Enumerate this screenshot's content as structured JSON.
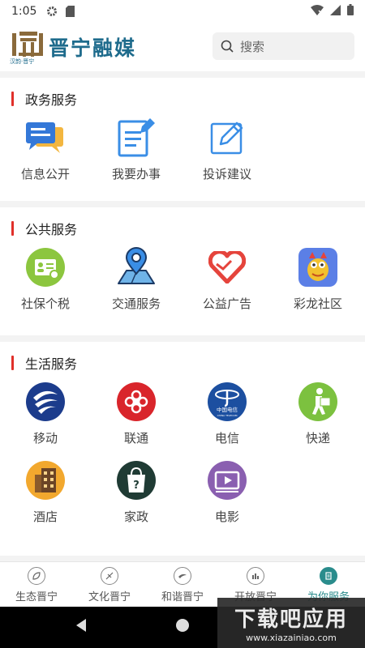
{
  "status": {
    "time": "1:05"
  },
  "header": {
    "app_name": "晋宁融媒",
    "logo_subtext": "汉韵·晋宁",
    "search_placeholder": "搜索"
  },
  "sections": [
    {
      "title": "政务服务",
      "items": [
        {
          "label": "信息公开",
          "icon": "info-disclosure-icon"
        },
        {
          "label": "我要办事",
          "icon": "handle-affairs-icon"
        },
        {
          "label": "投诉建议",
          "icon": "complaint-icon"
        }
      ]
    },
    {
      "title": "公共服务",
      "items": [
        {
          "label": "社保个税",
          "icon": "social-security-icon"
        },
        {
          "label": "交通服务",
          "icon": "traffic-icon"
        },
        {
          "label": "公益广告",
          "icon": "charity-icon"
        },
        {
          "label": "彩龙社区",
          "icon": "community-icon"
        }
      ]
    },
    {
      "title": "生活服务",
      "items": [
        {
          "label": "移动",
          "icon": "china-mobile-icon"
        },
        {
          "label": "联通",
          "icon": "china-unicom-icon"
        },
        {
          "label": "电信",
          "icon": "china-telecom-icon"
        },
        {
          "label": "快递",
          "icon": "express-icon"
        },
        {
          "label": "酒店",
          "icon": "hotel-icon"
        },
        {
          "label": "家政",
          "icon": "housekeeping-icon"
        },
        {
          "label": "电影",
          "icon": "movie-icon"
        }
      ]
    }
  ],
  "telecom_logo_text": {
    "cn": "中国电信",
    "en": "CHINA TELECOM"
  },
  "tabs": [
    {
      "label": "生态晋宁",
      "active": false
    },
    {
      "label": "文化晋宁",
      "active": false
    },
    {
      "label": "和谐晋宁",
      "active": false
    },
    {
      "label": "开放晋宁",
      "active": false
    },
    {
      "label": "为你服务",
      "active": true
    }
  ],
  "watermark": {
    "title": "下载吧应用",
    "url": "www.xiazainiao.com"
  },
  "colors": {
    "accent": "#2a8c8c",
    "section_bar": "#e0302a",
    "brand": "#1e6b8c"
  }
}
